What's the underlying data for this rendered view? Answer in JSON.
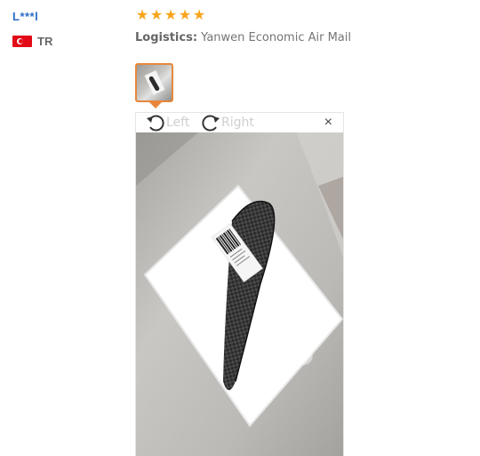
{
  "reviewer": {
    "name": "L***l",
    "country_code": "TR",
    "flag_icon": "turkey-flag-icon"
  },
  "review": {
    "rating": 5,
    "rating_max": 5,
    "star_color": "#f7a51c",
    "logistics_label": "Logistics:",
    "logistics_value": "Yanwen Economic Air Mail"
  },
  "gallery": {
    "active_thumb_border": "#e8873b"
  },
  "viewer": {
    "rotate_left_label": "Left",
    "rotate_right_label": "Right",
    "close_glyph": "×"
  }
}
